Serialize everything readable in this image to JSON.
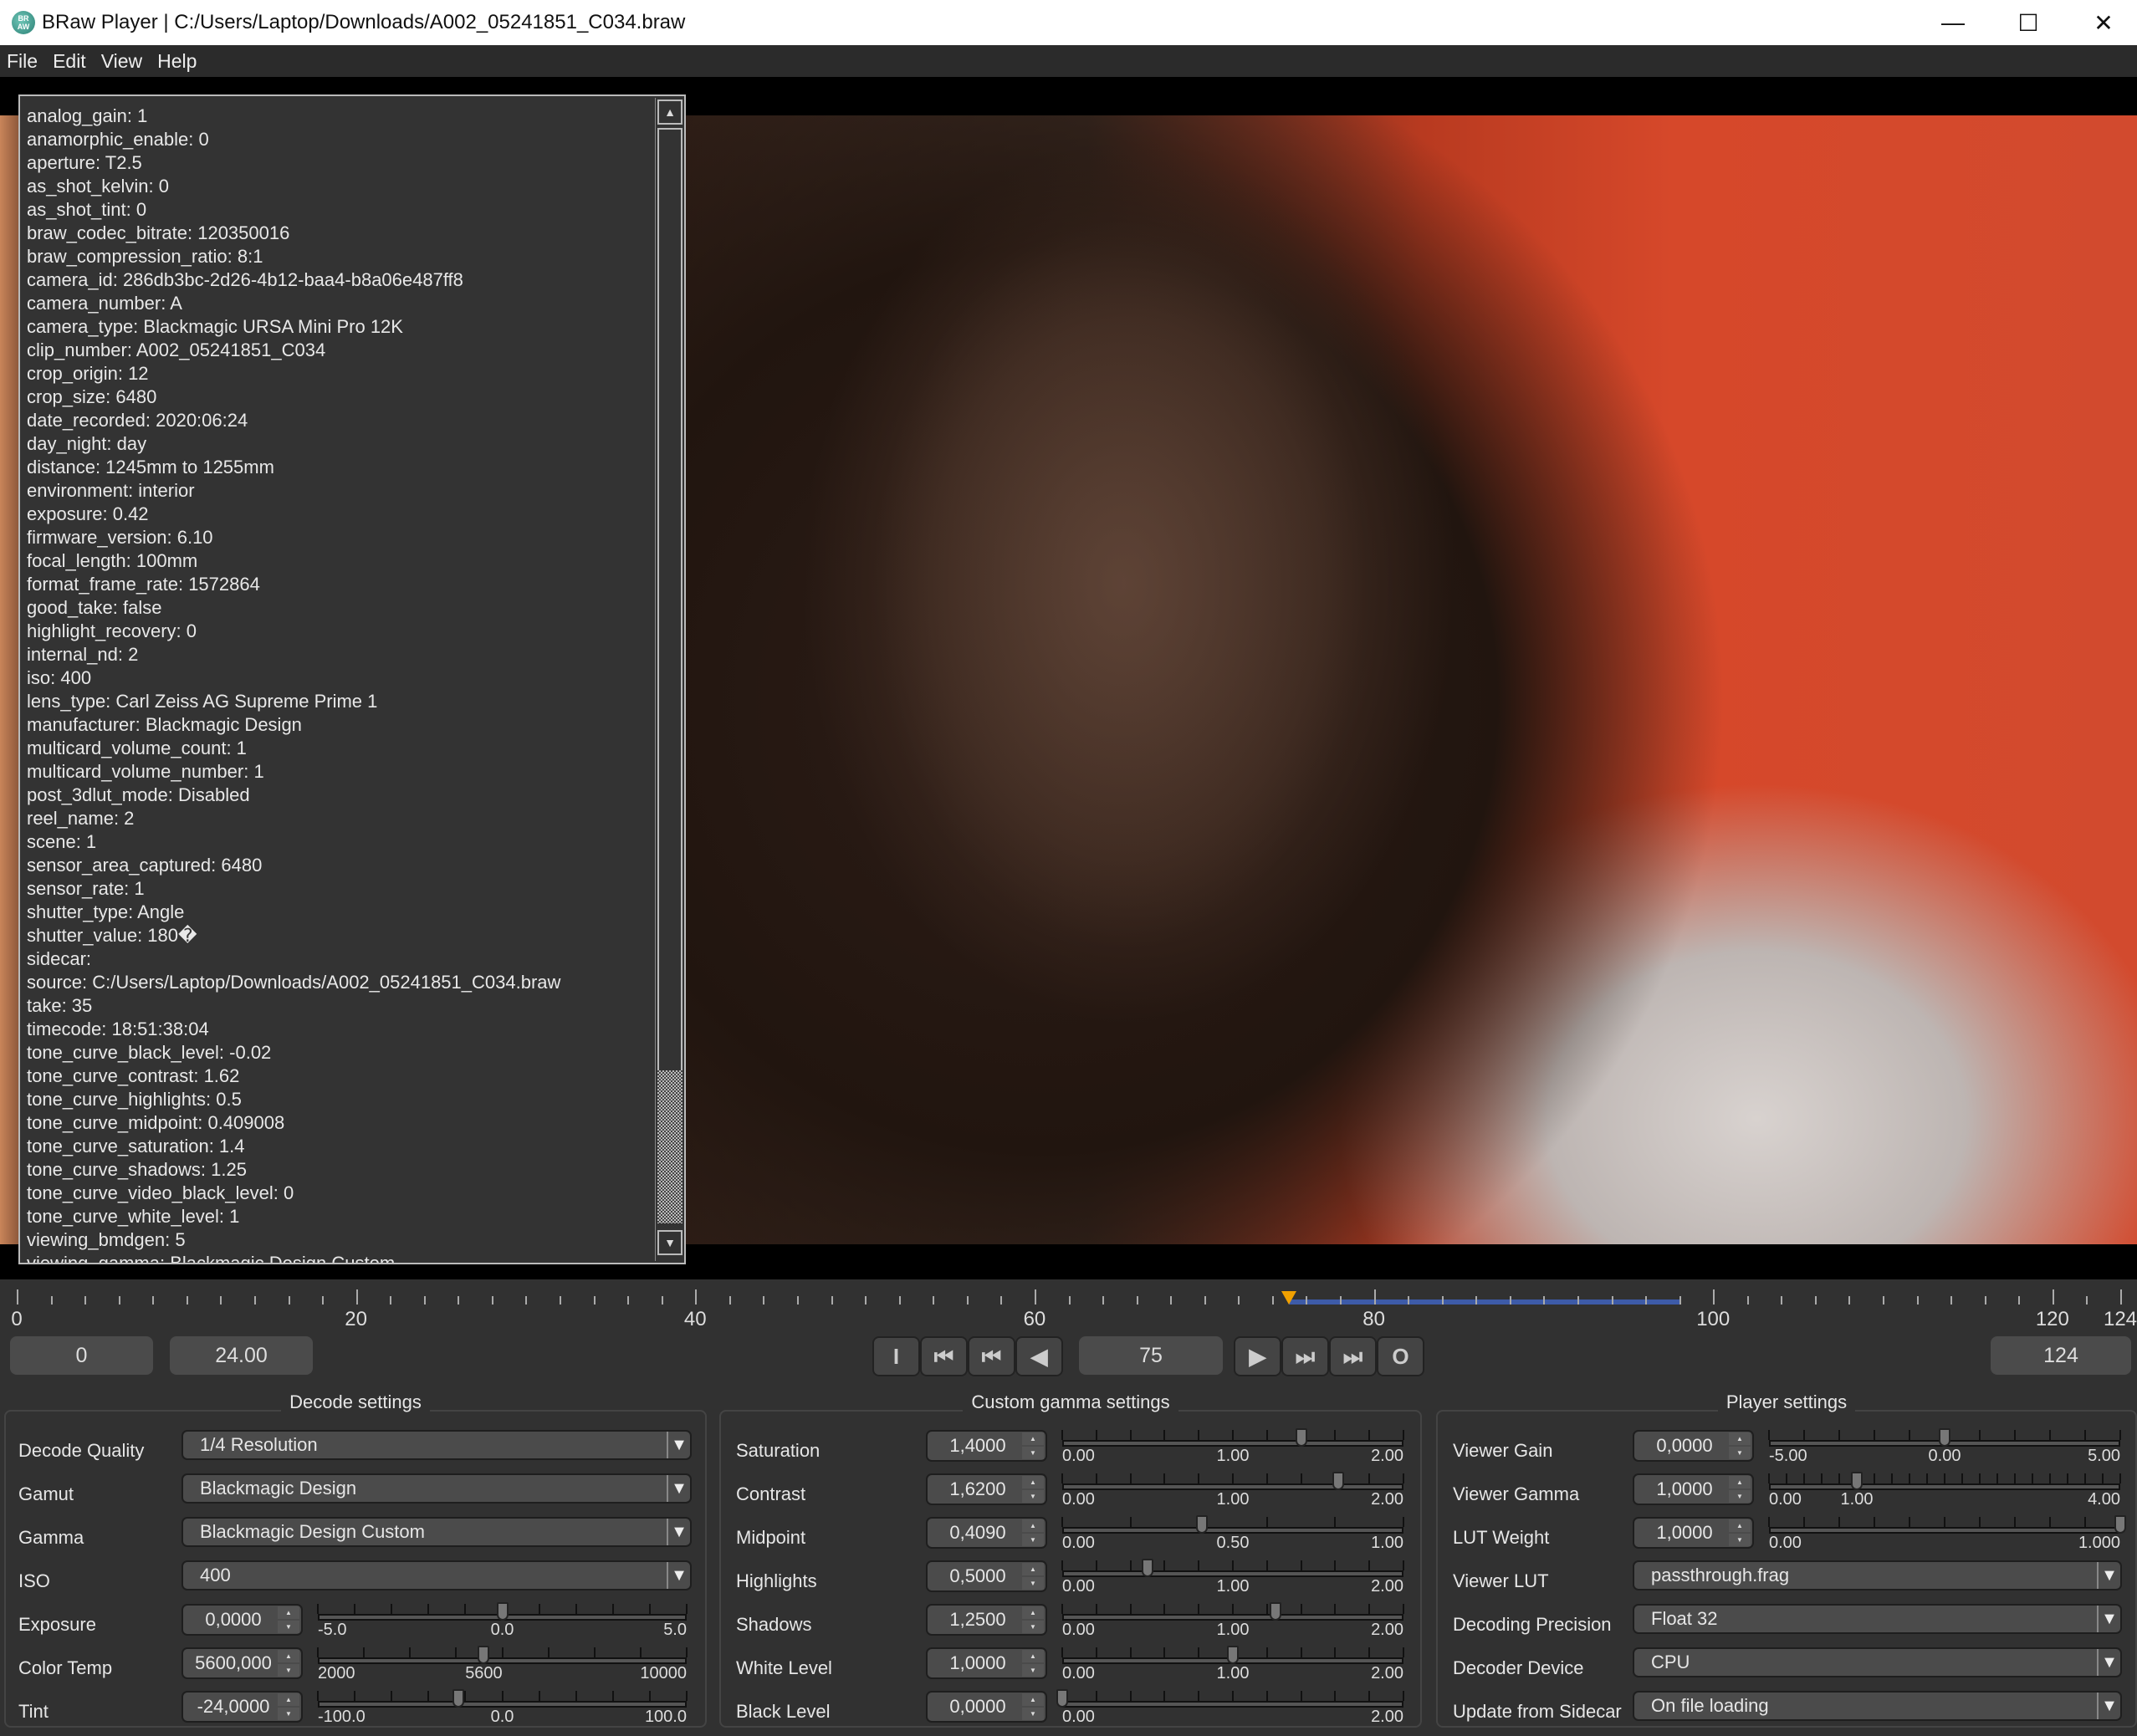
{
  "window": {
    "title": "BRaw Player | C:/Users/Laptop/Downloads/A002_05241851_C034.braw",
    "icon_text": "BR AW",
    "minimize": "—",
    "maximize": "☐",
    "close": "✕"
  },
  "menu": [
    "File",
    "Edit",
    "View",
    "Help"
  ],
  "metadata": [
    "analog_gain: 1",
    "anamorphic_enable: 0",
    "aperture: T2.5",
    "as_shot_kelvin: 0",
    "as_shot_tint: 0",
    "braw_codec_bitrate: 120350016",
    "braw_compression_ratio: 8:1",
    "camera_id: 286db3bc-2d26-4b12-baa4-b8a06e487ff8",
    "camera_number: A",
    "camera_type: Blackmagic URSA Mini Pro 12K",
    "clip_number: A002_05241851_C034",
    "crop_origin: 12",
    "crop_size: 6480",
    "date_recorded: 2020:06:24",
    "day_night: day",
    "distance: 1245mm to 1255mm",
    "environment: interior",
    "exposure: 0.42",
    "firmware_version: 6.10",
    "focal_length: 100mm",
    "format_frame_rate: 1572864",
    "good_take: false",
    "highlight_recovery: 0",
    "internal_nd: 2",
    "iso: 400",
    "lens_type: Carl Zeiss AG Supreme Prime 1",
    "manufacturer: Blackmagic Design",
    "multicard_volume_count: 1",
    "multicard_volume_number: 1",
    "post_3dlut_mode: Disabled",
    "reel_name: 2",
    "scene: 1",
    "sensor_area_captured: 6480",
    "sensor_rate: 1",
    "shutter_type: Angle",
    "shutter_value: 180�",
    "sidecar:",
    "source: C:/Users/Laptop/Downloads/A002_05241851_C034.braw",
    "take: 35",
    "timecode: 18:51:38:04",
    "tone_curve_black_level: -0.02",
    "tone_curve_contrast: 1.62",
    "tone_curve_highlights: 0.5",
    "tone_curve_midpoint: 0.409008",
    "tone_curve_saturation: 1.4",
    "tone_curve_shadows: 1.25",
    "tone_curve_video_black_level: 0",
    "tone_curve_white_level: 1",
    "viewing_bmdgen: 5",
    "viewing_gamma: Blackmagic Design Custom"
  ],
  "metadata_scroll": {
    "position_fraction": 0.86,
    "visible_fraction": 0.14,
    "up": "▲",
    "down": "▼"
  },
  "timeline": {
    "min": 0,
    "max": 124,
    "labels": [
      "0",
      "20",
      "40",
      "60",
      "80",
      "100",
      "120",
      "124"
    ],
    "label_values": [
      0,
      20,
      40,
      60,
      80,
      100,
      120,
      124
    ],
    "current": 75,
    "range_end": 98,
    "playhead_color": "#f0a000",
    "range_color": "#3d5ba8"
  },
  "controls": {
    "start_frame": "0",
    "fps": "24.00",
    "current_frame": "75",
    "end_frame": "124",
    "buttons": [
      {
        "name": "in-point",
        "glyph": "I"
      },
      {
        "name": "go-to-start",
        "glyph": "⏮"
      },
      {
        "name": "previous-frame",
        "glyph": "⏮"
      },
      {
        "name": "play-reverse",
        "glyph": "◀"
      },
      {
        "name": "play",
        "glyph": "▶"
      },
      {
        "name": "next-frame",
        "glyph": "⏭"
      },
      {
        "name": "go-to-end",
        "glyph": "⏭"
      },
      {
        "name": "out-point",
        "glyph": "O"
      }
    ]
  },
  "groups": [
    {
      "title": "Decode settings",
      "rows": [
        {
          "label": "Decode Quality",
          "type": "combo",
          "value": "1/4 Resolution"
        },
        {
          "label": "Gamut",
          "type": "combo",
          "value": "Blackmagic Design"
        },
        {
          "label": "Gamma",
          "type": "combo",
          "value": "Blackmagic Design Custom"
        },
        {
          "label": "ISO",
          "type": "combo",
          "value": "400"
        },
        {
          "label": "Exposure",
          "type": "slider",
          "value": "0,0000",
          "num": 0,
          "min": -5,
          "max": 5,
          "ticks": 10,
          "labels": [
            {
              "t": "-5.0",
              "v": -5
            },
            {
              "t": "0.0",
              "v": 0
            },
            {
              "t": "5.0",
              "v": 5
            }
          ]
        },
        {
          "label": "Color Temp",
          "type": "slider",
          "value": "5600,000",
          "num": 5600,
          "min": 2000,
          "max": 10000,
          "ticks": 8,
          "labels": [
            {
              "t": "2000",
              "v": 2000
            },
            {
              "t": "5600",
              "v": 5600
            },
            {
              "t": "10000",
              "v": 10000
            }
          ]
        },
        {
          "label": "Tint",
          "type": "slider",
          "value": "-24,0000",
          "num": -24,
          "min": -100,
          "max": 100,
          "ticks": 10,
          "labels": [
            {
              "t": "-100.0",
              "v": -100
            },
            {
              "t": "0.0",
              "v": 0
            },
            {
              "t": "100.0",
              "v": 100
            }
          ]
        }
      ]
    },
    {
      "title": "Custom gamma settings",
      "rows": [
        {
          "label": "Saturation",
          "type": "slider",
          "value": "1,4000",
          "num": 1.4,
          "min": 0,
          "max": 2,
          "ticks": 10,
          "labels": [
            {
              "t": "0.00",
              "v": 0
            },
            {
              "t": "1.00",
              "v": 1
            },
            {
              "t": "2.00",
              "v": 2
            }
          ]
        },
        {
          "label": "Contrast",
          "type": "slider",
          "value": "1,6200",
          "num": 1.62,
          "min": 0,
          "max": 2,
          "ticks": 10,
          "labels": [
            {
              "t": "0.00",
              "v": 0
            },
            {
              "t": "1.00",
              "v": 1
            },
            {
              "t": "2.00",
              "v": 2
            }
          ]
        },
        {
          "label": "Midpoint",
          "type": "slider",
          "value": "0,4090",
          "num": 0.409,
          "min": 0,
          "max": 1,
          "ticks": 5,
          "labels": [
            {
              "t": "0.00",
              "v": 0
            },
            {
              "t": "0.50",
              "v": 0.5
            },
            {
              "t": "1.00",
              "v": 1
            }
          ]
        },
        {
          "label": "Highlights",
          "type": "slider",
          "value": "0,5000",
          "num": 0.5,
          "min": 0,
          "max": 2,
          "ticks": 10,
          "labels": [
            {
              "t": "0.00",
              "v": 0
            },
            {
              "t": "1.00",
              "v": 1
            },
            {
              "t": "2.00",
              "v": 2
            }
          ]
        },
        {
          "label": "Shadows",
          "type": "slider",
          "value": "1,2500",
          "num": 1.25,
          "min": 0,
          "max": 2,
          "ticks": 10,
          "labels": [
            {
              "t": "0.00",
              "v": 0
            },
            {
              "t": "1.00",
              "v": 1
            },
            {
              "t": "2.00",
              "v": 2
            }
          ]
        },
        {
          "label": "White Level",
          "type": "slider",
          "value": "1,0000",
          "num": 1,
          "min": 0,
          "max": 2,
          "ticks": 10,
          "labels": [
            {
              "t": "0.00",
              "v": 0
            },
            {
              "t": "1.00",
              "v": 1
            },
            {
              "t": "2.00",
              "v": 2
            }
          ]
        },
        {
          "label": "Black Level",
          "type": "slider",
          "value": "0,0000",
          "num": 0,
          "min": 0,
          "max": 2,
          "ticks": 10,
          "labels": [
            {
              "t": "0.00",
              "v": 0
            },
            {
              "t": "2.00",
              "v": 2
            }
          ]
        }
      ]
    },
    {
      "title": "Player settings",
      "rows": [
        {
          "label": "Viewer Gain",
          "type": "slider",
          "value": "0,0000",
          "num": 0,
          "min": -5,
          "max": 5,
          "ticks": 10,
          "labels": [
            {
              "t": "-5.00",
              "v": -5
            },
            {
              "t": "0.00",
              "v": 0
            },
            {
              "t": "5.00",
              "v": 5
            }
          ]
        },
        {
          "label": "Viewer Gamma",
          "type": "slider",
          "value": "1,0000",
          "num": 1,
          "min": 0,
          "max": 4,
          "ticks": 20,
          "labels": [
            {
              "t": "0.00",
              "v": 0
            },
            {
              "t": "1.00",
              "v": 1
            },
            {
              "t": "4.00",
              "v": 4
            }
          ]
        },
        {
          "label": "LUT Weight",
          "type": "slider",
          "value": "1,0000",
          "num": 1,
          "min": 0,
          "max": 1,
          "ticks": 10,
          "labels": [
            {
              "t": "0.00",
              "v": 0
            },
            {
              "t": "1.000",
              "v": 1
            }
          ]
        },
        {
          "label": "Viewer LUT",
          "type": "combo",
          "value": "passthrough.frag"
        },
        {
          "label": "Decoding Precision",
          "type": "combo",
          "value": "Float 32"
        },
        {
          "label": "Decoder Device",
          "type": "combo",
          "value": "CPU"
        },
        {
          "label": "Update from Sidecar",
          "type": "combo",
          "value": "On file loading"
        }
      ]
    }
  ]
}
